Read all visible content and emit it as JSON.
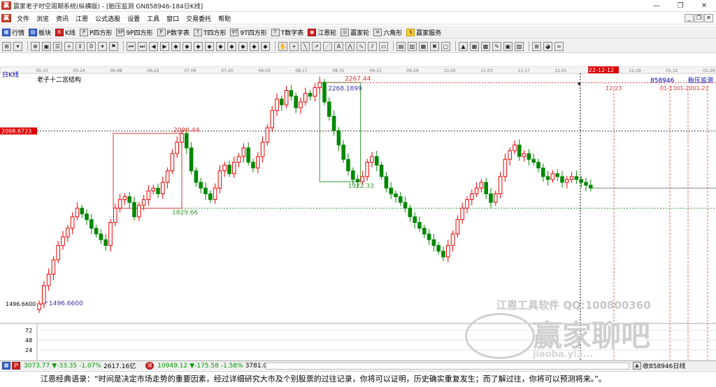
{
  "window": {
    "title": "赢家老子时空周期系统(纵横版) - [胎压监测 GN858946-184日K线]",
    "controls": [
      "—",
      "❐",
      "✕"
    ],
    "mdi_controls": [
      "_",
      "❐",
      "✕"
    ]
  },
  "menu": [
    "文件",
    "浏览",
    "资讯",
    "江恩",
    "公式选股",
    "设置",
    "工具",
    "窗口",
    "交易委托",
    "帮助"
  ],
  "toolbar1": [
    {
      "icon": "grid-icon",
      "label": "行情"
    },
    {
      "icon": "block-icon",
      "label": "板块"
    },
    {
      "icon": "k-icon",
      "label": "K线"
    },
    {
      "icon": "P",
      "label": "P四方形"
    },
    {
      "icon": "9P",
      "label": "9P四方形"
    },
    {
      "icon": "P",
      "label": "P数字表"
    },
    {
      "icon": "T",
      "label": "T四方形"
    },
    {
      "icon": "9T",
      "label": "9T四方形"
    },
    {
      "icon": "T",
      "label": "T数字表"
    },
    {
      "icon": "wheel-icon",
      "label": "江恩轮"
    },
    {
      "icon": "wheel-icon",
      "label": "赢家轮"
    },
    {
      "icon": "star-icon",
      "label": "六角形"
    },
    {
      "icon": "dollar-icon",
      "label": "赢家服务"
    }
  ],
  "chart_data": {
    "type": "candlestick",
    "period_label": "日K线",
    "study_title": "老子十二宫结构",
    "date_ticks": [
      "05-10",
      "05-24",
      "06-08",
      "06-22",
      "07-06",
      "07-20",
      "08-03",
      "08-17",
      "08-31",
      "09-15",
      "09-29",
      "10-20",
      "11-03",
      "11-17",
      "12-01",
      "2022-12-12",
      "12-29",
      "01-12",
      "01-26"
    ],
    "highlight_date": "2022-12-12",
    "left_price_tags": [
      "2098.8723",
      "1496.6600"
    ],
    "price_labels": {
      "high1": "2090.44",
      "low1": "1829.66",
      "high2": "2267.44",
      "high2b": "2268.1899",
      "low2": "1922.33",
      "origin": "1496.6600"
    },
    "right_labels": {
      "code": "858946",
      "name": "胎压监测",
      "date1": "12-23",
      "dates2": "01-1301-2001-27"
    },
    "volume_ticks": [
      "72",
      "48",
      "24"
    ],
    "ylim": [
      1460,
      2290
    ],
    "closes": [
      1496.66,
      1560,
      1600,
      1650,
      1700,
      1730,
      1760,
      1800,
      1830,
      1810,
      1790,
      1760,
      1740,
      1720,
      1700,
      1780,
      1830,
      1860,
      1870,
      1850,
      1800,
      1840,
      1860,
      1890,
      1900,
      1880,
      1920,
      1960,
      2020,
      2060,
      2090,
      2040,
      1960,
      1920,
      1900,
      1880,
      1860,
      1900,
      1960,
      1980,
      1950,
      1990,
      2010,
      2040,
      1990,
      1970,
      2010,
      2060,
      2110,
      2170,
      2210,
      2190,
      2240,
      2220,
      2180,
      2200,
      2230,
      2220,
      2250,
      2268,
      2200,
      2150,
      2100,
      2050,
      2000,
      1960,
      1930,
      1922,
      1940,
      1990,
      2010,
      1980,
      1940,
      1900,
      1880,
      1870,
      1850,
      1830,
      1800,
      1780,
      1760,
      1740,
      1720,
      1700,
      1680,
      1660,
      1700,
      1740,
      1790,
      1830,
      1860,
      1880,
      1900,
      1920,
      1880,
      1850,
      1880,
      1940,
      2000,
      2030,
      2050,
      2010,
      2020,
      2000,
      1990,
      1970,
      1940,
      1930,
      1950,
      1940,
      1920,
      1930,
      1940,
      1930,
      1920,
      1910,
      1900
    ]
  },
  "watermark": {
    "line1": "江恩工具软件  QQ:100800360",
    "line2": "赢家聊吧",
    "line3": "jiaoba.yi3..."
  },
  "status": {
    "index1_value": "3073.77",
    "index1_change": "▼-33.35",
    "index1_pct": "-1.07%",
    "index1_vol": "2617.16亿",
    "index2_value": "10949.12",
    "index2_change": "▼-175.58",
    "index2_pct": "-1.58%",
    "index2_vol": "3781.0",
    "right": "收858946日线"
  },
  "quote": "江恩经典语录：“时间是决定市场走势的重要因素，经过详细研究大市及个别股票的过往记录，你将可以证明，历史确实重复发生；而了解过往，你将可以预测将来。”。"
}
